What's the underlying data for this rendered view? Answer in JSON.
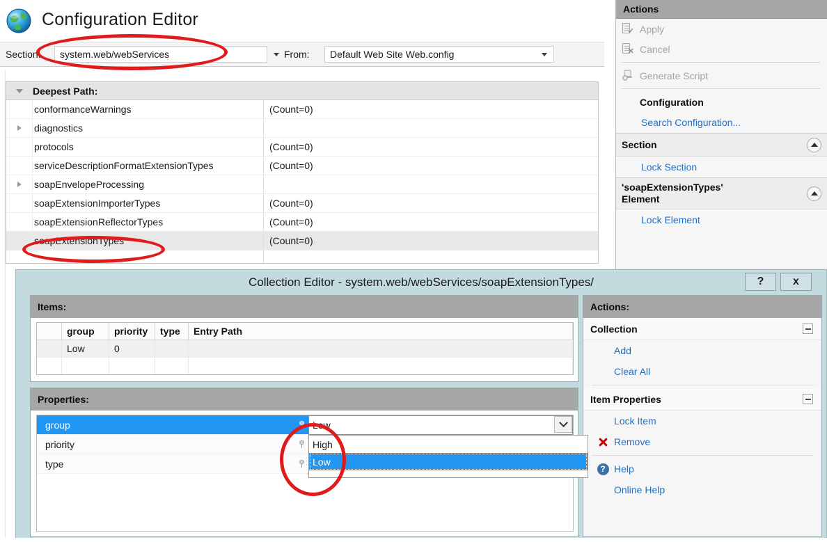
{
  "header": {
    "title": "Configuration Editor",
    "globe_icon": "globe-icon",
    "section_label": "Section:",
    "section_value": "system.web/webServices",
    "from_label": "From:",
    "from_value": "Default Web Site Web.config"
  },
  "tree": {
    "header": "Deepest Path:",
    "rows": [
      {
        "name": "conformanceWarnings",
        "value": "(Count=0)",
        "expandable": false,
        "selected": false
      },
      {
        "name": "diagnostics",
        "value": "",
        "expandable": true,
        "selected": false
      },
      {
        "name": "protocols",
        "value": "(Count=0)",
        "expandable": false,
        "selected": false
      },
      {
        "name": "serviceDescriptionFormatExtensionTypes",
        "value": "(Count=0)",
        "expandable": false,
        "selected": false
      },
      {
        "name": "soapEnvelopeProcessing",
        "value": "",
        "expandable": true,
        "selected": false
      },
      {
        "name": "soapExtensionImporterTypes",
        "value": "(Count=0)",
        "expandable": false,
        "selected": false
      },
      {
        "name": "soapExtensionReflectorTypes",
        "value": "(Count=0)",
        "expandable": false,
        "selected": false
      },
      {
        "name": "soapExtensionTypes",
        "value": "(Count=0)",
        "expandable": false,
        "selected": true
      }
    ]
  },
  "actions_pane": {
    "title": "Actions",
    "apply": "Apply",
    "cancel": "Cancel",
    "generate_script": "Generate Script",
    "configuration_group": "Configuration",
    "search_configuration": "Search Configuration...",
    "section_group": "Section",
    "lock_section": "Lock Section",
    "element_group": "'soapExtensionTypes'\nElement",
    "lock_element": "Lock Element"
  },
  "dialog": {
    "title": "Collection Editor - system.web/webServices/soapExtensionTypes/",
    "help_button": "?",
    "close_button": "x",
    "items": {
      "header": "Items:",
      "columns": [
        "",
        "group",
        "priority",
        "type",
        "Entry Path"
      ],
      "rows": [
        {
          "sel": "",
          "group": "Low",
          "priority": "0",
          "type": "",
          "entry_path": ""
        }
      ]
    },
    "properties": {
      "header": "Properties:",
      "rows": [
        {
          "name": "group",
          "value": "Low",
          "selected": true,
          "editing": true
        },
        {
          "name": "priority",
          "value": "",
          "selected": false,
          "editing": false
        },
        {
          "name": "type",
          "value": "",
          "selected": false,
          "editing": false
        }
      ],
      "dropdown_open": true,
      "dropdown_options": [
        "High",
        "Low"
      ],
      "dropdown_selected": "Low"
    },
    "actions": {
      "title": "Actions:",
      "collection_group": "Collection",
      "add": "Add",
      "clear_all": "Clear All",
      "item_properties_group": "Item Properties",
      "lock_item": "Lock Item",
      "remove": "Remove",
      "help": "Help",
      "online_help": "Online Help"
    }
  },
  "colors": {
    "accent_blue": "#2196f3",
    "link_blue": "#1f6fc4",
    "dialog_chrome": "#c3dade",
    "panel_header_grey": "#a6a6a6",
    "annotation_red": "#e01b1b"
  }
}
